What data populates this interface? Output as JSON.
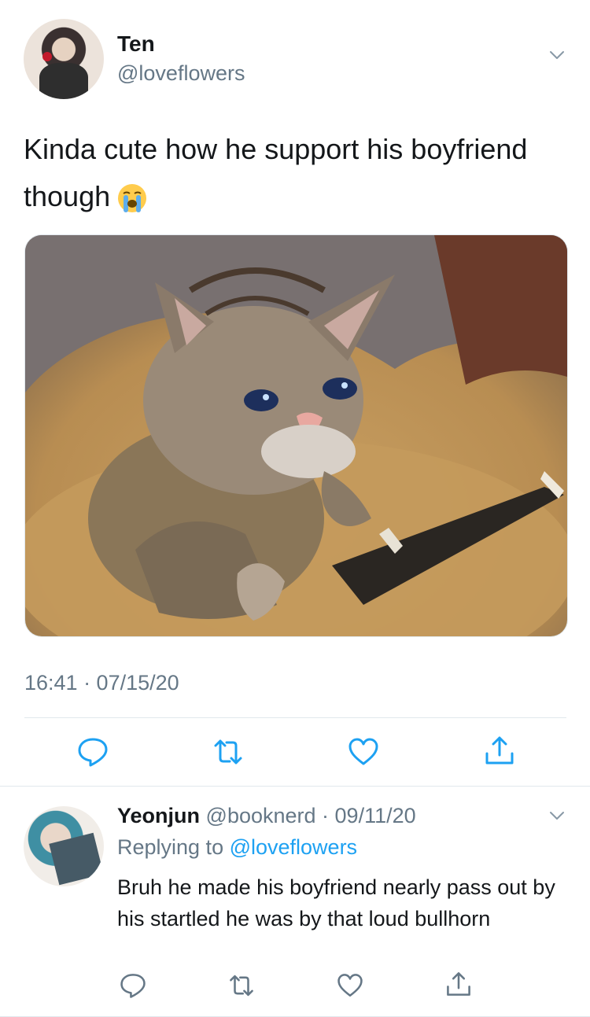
{
  "tweet": {
    "display_name": "Ten",
    "handle": "@loveflowers",
    "text": "Kinda cute how he support his boyfriend though",
    "emoji_icon": "loudly-crying-face-emoji",
    "media_description_icon": "crying-cat-holding-phone-image",
    "timestamp": "16:41 · 07/15/20",
    "actions": [
      "reply-icon",
      "retweet-icon",
      "like-icon",
      "share-icon"
    ]
  },
  "reply": {
    "display_name": "Yeonjun",
    "handle": "@booknerd",
    "separator": " · ",
    "date": "09/11/20",
    "replying_prefix": "Replying to ",
    "replying_to": "@loveflowers",
    "text": "Bruh he made his boyfriend nearly pass out by his startled he was by that loud bullhorn",
    "actions": [
      "reply-icon",
      "retweet-icon",
      "like-icon",
      "share-icon"
    ]
  },
  "colors": {
    "text_primary": "#14171a",
    "text_secondary": "#657786",
    "link": "#1da1f2",
    "divider": "#e1e8ed"
  }
}
